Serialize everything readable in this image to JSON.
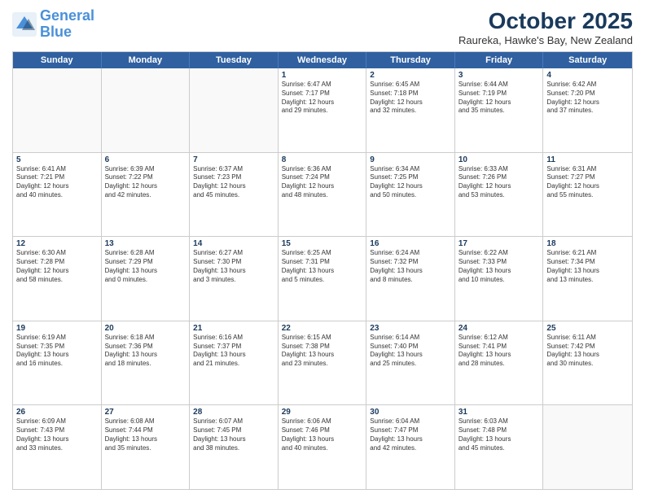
{
  "header": {
    "logo_line1": "General",
    "logo_line2": "Blue",
    "title": "October 2025",
    "subtitle": "Raureka, Hawke's Bay, New Zealand"
  },
  "weekdays": [
    "Sunday",
    "Monday",
    "Tuesday",
    "Wednesday",
    "Thursday",
    "Friday",
    "Saturday"
  ],
  "rows": [
    [
      {
        "day": "",
        "info": ""
      },
      {
        "day": "",
        "info": ""
      },
      {
        "day": "",
        "info": ""
      },
      {
        "day": "1",
        "info": "Sunrise: 6:47 AM\nSunset: 7:17 PM\nDaylight: 12 hours\nand 29 minutes."
      },
      {
        "day": "2",
        "info": "Sunrise: 6:45 AM\nSunset: 7:18 PM\nDaylight: 12 hours\nand 32 minutes."
      },
      {
        "day": "3",
        "info": "Sunrise: 6:44 AM\nSunset: 7:19 PM\nDaylight: 12 hours\nand 35 minutes."
      },
      {
        "day": "4",
        "info": "Sunrise: 6:42 AM\nSunset: 7:20 PM\nDaylight: 12 hours\nand 37 minutes."
      }
    ],
    [
      {
        "day": "5",
        "info": "Sunrise: 6:41 AM\nSunset: 7:21 PM\nDaylight: 12 hours\nand 40 minutes."
      },
      {
        "day": "6",
        "info": "Sunrise: 6:39 AM\nSunset: 7:22 PM\nDaylight: 12 hours\nand 42 minutes."
      },
      {
        "day": "7",
        "info": "Sunrise: 6:37 AM\nSunset: 7:23 PM\nDaylight: 12 hours\nand 45 minutes."
      },
      {
        "day": "8",
        "info": "Sunrise: 6:36 AM\nSunset: 7:24 PM\nDaylight: 12 hours\nand 48 minutes."
      },
      {
        "day": "9",
        "info": "Sunrise: 6:34 AM\nSunset: 7:25 PM\nDaylight: 12 hours\nand 50 minutes."
      },
      {
        "day": "10",
        "info": "Sunrise: 6:33 AM\nSunset: 7:26 PM\nDaylight: 12 hours\nand 53 minutes."
      },
      {
        "day": "11",
        "info": "Sunrise: 6:31 AM\nSunset: 7:27 PM\nDaylight: 12 hours\nand 55 minutes."
      }
    ],
    [
      {
        "day": "12",
        "info": "Sunrise: 6:30 AM\nSunset: 7:28 PM\nDaylight: 12 hours\nand 58 minutes."
      },
      {
        "day": "13",
        "info": "Sunrise: 6:28 AM\nSunset: 7:29 PM\nDaylight: 13 hours\nand 0 minutes."
      },
      {
        "day": "14",
        "info": "Sunrise: 6:27 AM\nSunset: 7:30 PM\nDaylight: 13 hours\nand 3 minutes."
      },
      {
        "day": "15",
        "info": "Sunrise: 6:25 AM\nSunset: 7:31 PM\nDaylight: 13 hours\nand 5 minutes."
      },
      {
        "day": "16",
        "info": "Sunrise: 6:24 AM\nSunset: 7:32 PM\nDaylight: 13 hours\nand 8 minutes."
      },
      {
        "day": "17",
        "info": "Sunrise: 6:22 AM\nSunset: 7:33 PM\nDaylight: 13 hours\nand 10 minutes."
      },
      {
        "day": "18",
        "info": "Sunrise: 6:21 AM\nSunset: 7:34 PM\nDaylight: 13 hours\nand 13 minutes."
      }
    ],
    [
      {
        "day": "19",
        "info": "Sunrise: 6:19 AM\nSunset: 7:35 PM\nDaylight: 13 hours\nand 16 minutes."
      },
      {
        "day": "20",
        "info": "Sunrise: 6:18 AM\nSunset: 7:36 PM\nDaylight: 13 hours\nand 18 minutes."
      },
      {
        "day": "21",
        "info": "Sunrise: 6:16 AM\nSunset: 7:37 PM\nDaylight: 13 hours\nand 21 minutes."
      },
      {
        "day": "22",
        "info": "Sunrise: 6:15 AM\nSunset: 7:38 PM\nDaylight: 13 hours\nand 23 minutes."
      },
      {
        "day": "23",
        "info": "Sunrise: 6:14 AM\nSunset: 7:40 PM\nDaylight: 13 hours\nand 25 minutes."
      },
      {
        "day": "24",
        "info": "Sunrise: 6:12 AM\nSunset: 7:41 PM\nDaylight: 13 hours\nand 28 minutes."
      },
      {
        "day": "25",
        "info": "Sunrise: 6:11 AM\nSunset: 7:42 PM\nDaylight: 13 hours\nand 30 minutes."
      }
    ],
    [
      {
        "day": "26",
        "info": "Sunrise: 6:09 AM\nSunset: 7:43 PM\nDaylight: 13 hours\nand 33 minutes."
      },
      {
        "day": "27",
        "info": "Sunrise: 6:08 AM\nSunset: 7:44 PM\nDaylight: 13 hours\nand 35 minutes."
      },
      {
        "day": "28",
        "info": "Sunrise: 6:07 AM\nSunset: 7:45 PM\nDaylight: 13 hours\nand 38 minutes."
      },
      {
        "day": "29",
        "info": "Sunrise: 6:06 AM\nSunset: 7:46 PM\nDaylight: 13 hours\nand 40 minutes."
      },
      {
        "day": "30",
        "info": "Sunrise: 6:04 AM\nSunset: 7:47 PM\nDaylight: 13 hours\nand 42 minutes."
      },
      {
        "day": "31",
        "info": "Sunrise: 6:03 AM\nSunset: 7:48 PM\nDaylight: 13 hours\nand 45 minutes."
      },
      {
        "day": "",
        "info": ""
      }
    ]
  ]
}
